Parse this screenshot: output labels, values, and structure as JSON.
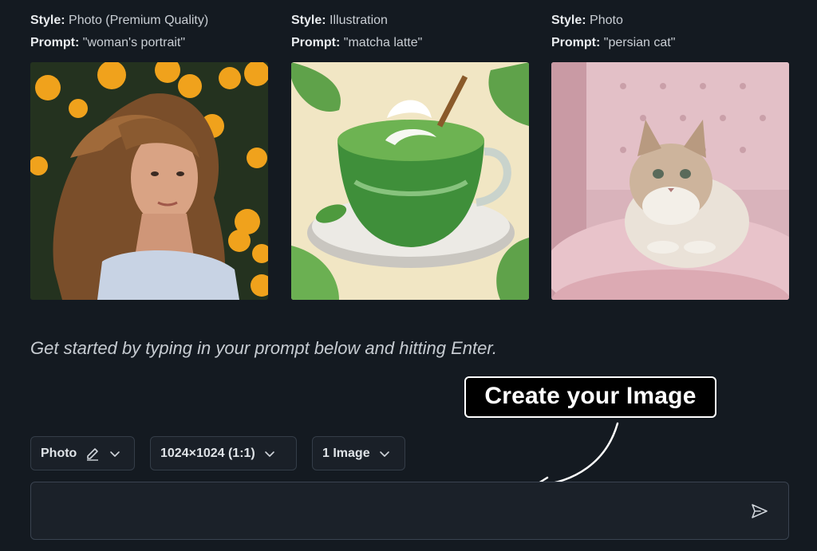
{
  "examples": [
    {
      "style_label": "Style:",
      "style_value": "Photo (Premium Quality)",
      "prompt_label": "Prompt:",
      "prompt_value": "\"woman's portrait\""
    },
    {
      "style_label": "Style:",
      "style_value": "Illustration",
      "prompt_label": "Prompt:",
      "prompt_value": "\"matcha latte\""
    },
    {
      "style_label": "Style:",
      "style_value": "Photo",
      "prompt_label": "Prompt:",
      "prompt_value": "\"persian cat\""
    }
  ],
  "hint": "Get started by typing in your prompt below and hitting Enter.",
  "callout": "Create your Image",
  "controls": {
    "style": {
      "value": "Photo",
      "edit_icon": "edit-icon",
      "chevron_icon": "chevron-down-icon"
    },
    "size": {
      "value": "1024×1024 (1:1)",
      "chevron_icon": "chevron-down-icon"
    },
    "count": {
      "value": "1 Image",
      "chevron_icon": "chevron-down-icon"
    }
  },
  "prompt": {
    "value": "",
    "placeholder": "",
    "send_icon": "send-icon"
  },
  "colors": {
    "background": "#141a21",
    "border": "#343d48",
    "callout_bg": "#000000"
  }
}
